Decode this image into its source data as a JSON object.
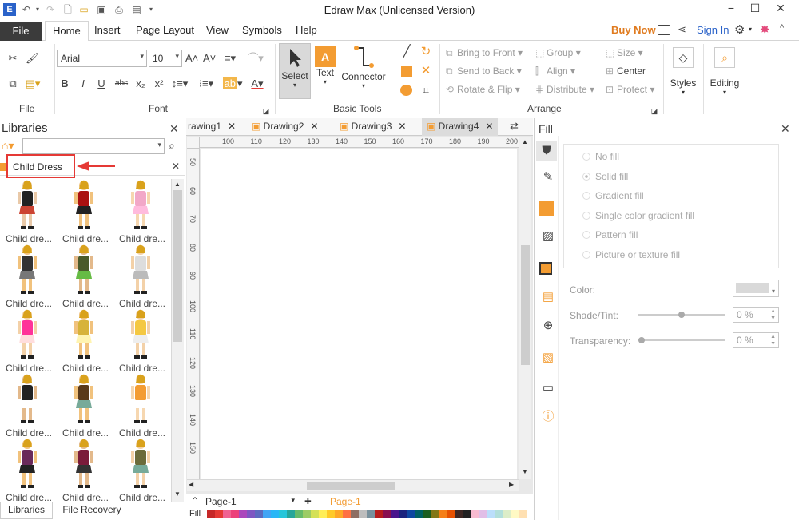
{
  "app": {
    "title": "Edraw Max (Unlicensed Version)"
  },
  "ribbon_tabs": {
    "file": "File",
    "home": "Home",
    "insert": "Insert",
    "page_layout": "Page Layout",
    "view": "View",
    "symbols": "Symbols",
    "help": "Help"
  },
  "account": {
    "buy_now": "Buy Now",
    "sign_in": "Sign In"
  },
  "font": {
    "family": "Arial",
    "size": "10",
    "group_label": "Font"
  },
  "groups": {
    "file": "File",
    "basic_tools": "Basic Tools",
    "arrange": "Arrange"
  },
  "basic_tools": {
    "select": "Select",
    "text": "Text",
    "connector": "Connector"
  },
  "arrange": {
    "bring_to_front": "Bring to Front",
    "send_to_back": "Send to Back",
    "rotate_flip": "Rotate & Flip",
    "group": "Group",
    "align": "Align",
    "distribute": "Distribute",
    "size": "Size",
    "center": "Center",
    "protect": "Protect"
  },
  "styles": "Styles",
  "editing": "Editing",
  "libraries": {
    "title": "Libraries",
    "search_value": "",
    "category": "Child Dress",
    "items": [
      "Child dre...",
      "Child dre...",
      "Child dre...",
      "Child dre...",
      "Child dre...",
      "Child dre...",
      "Child dre...",
      "Child dre...",
      "Child dre...",
      "Child dre...",
      "Child dre...",
      "Child dre...",
      "Child dre...",
      "Child dre...",
      "Child dre..."
    ],
    "bottom_tabs": {
      "libraries": "Libraries",
      "file_recovery": "File Recovery"
    }
  },
  "doc_tabs": [
    "rawing1",
    "Drawing2",
    "Drawing3",
    "Drawing4"
  ],
  "ruler": {
    "h": [
      "100",
      "110",
      "120",
      "130",
      "140",
      "150",
      "160",
      "170",
      "180",
      "190",
      "200"
    ],
    "v": [
      "50",
      "60",
      "70",
      "80",
      "90",
      "100",
      "110",
      "120",
      "130",
      "140",
      "150"
    ]
  },
  "pages": {
    "selector": "Page-1",
    "active": "Page-1"
  },
  "fill_label": "Fill",
  "fill_panel": {
    "title": "Fill",
    "options": [
      "No fill",
      "Solid fill",
      "Gradient fill",
      "Single color gradient fill",
      "Pattern fill",
      "Picture or texture fill"
    ],
    "selected": "Solid fill",
    "color_label": "Color:",
    "shade_label": "Shade/Tint:",
    "shade_value": "0 %",
    "transparency_label": "Transparency:",
    "transparency_value": "0 %"
  },
  "colors": {
    "accent_orange": "#f39c32",
    "highlight_red": "#e53935",
    "file_tab": "#3b3b3b",
    "link_blue": "#2a62c9"
  }
}
